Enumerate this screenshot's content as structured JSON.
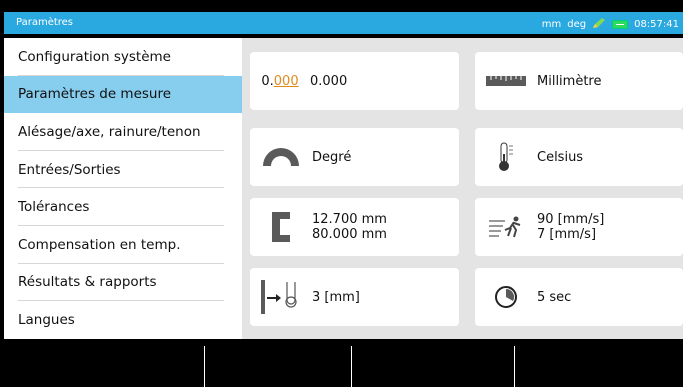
{
  "header": {
    "title": "Paramètres",
    "units_length": "mm",
    "units_angle": "deg",
    "time": "08:57:41"
  },
  "sidebar": {
    "items": [
      {
        "label": "Configuration système"
      },
      {
        "label": "Paramètres de mesure",
        "selected": true
      },
      {
        "label": "Alésage/axe, rainure/tenon"
      },
      {
        "label": "Entrées/Sorties"
      },
      {
        "label": "Tolérances"
      },
      {
        "label": "Compensation en temp."
      },
      {
        "label": "Résultats & rapports"
      },
      {
        "label": "Langues"
      }
    ]
  },
  "settings": {
    "resolution": {
      "icon": "resolution-icon",
      "icon_int": "0.",
      "icon_dec": "000",
      "value": "0.000"
    },
    "length_unit": {
      "icon": "ruler-icon",
      "value": "Millimètre"
    },
    "angle_unit": {
      "icon": "protractor-icon",
      "value": "Degré"
    },
    "temperature_unit": {
      "icon": "thermometer-icon",
      "value": "Celsius"
    },
    "probe_dimensions": {
      "icon": "probe-block-icon",
      "line1": "12.700 mm",
      "line2": "80.000 mm"
    },
    "speed": {
      "icon": "running-speed-icon",
      "line1": "90 [mm/s]",
      "line2": "7 [mm/s]"
    },
    "approach_distance": {
      "icon": "probe-approach-icon",
      "value": "3 [mm]"
    },
    "timeout": {
      "icon": "clock-icon",
      "value": "5 sec"
    }
  },
  "colors": {
    "titlebar": "#2aa8e0",
    "selected": "#87cdee",
    "battery": "#2ddb5c",
    "icon_gray": "#5a5a5a"
  }
}
